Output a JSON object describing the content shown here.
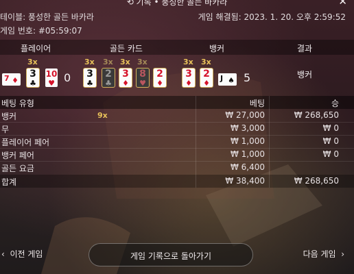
{
  "header": {
    "title": "⟲ 기록 • 풍성한 골든 바카라",
    "close_icon": "close-icon",
    "table_label": "테이블: 풍성한 골든 바카라",
    "settled_label": "게임 해결됨: 2023. 1. 20. 오후 2:59:52",
    "game_number_label": "게임 번호: #05:59:07"
  },
  "result_table": {
    "columns": [
      "플레이어",
      "골든 카드",
      "뱅커",
      "결과"
    ],
    "player": {
      "cards": [
        {
          "rank": "7",
          "suit": "♦",
          "color": "red",
          "sideways": true
        },
        {
          "rank": "3",
          "suit": "♣",
          "color": "black",
          "multiplier": "3x"
        },
        {
          "rank": "10",
          "suit": "♥",
          "color": "red"
        }
      ],
      "score": "0"
    },
    "golden_cards": [
      {
        "rank": "3",
        "suit": "♣",
        "color": "black",
        "multiplier": "3x",
        "active": true
      },
      {
        "rank": "2",
        "suit": "♣",
        "color": "black",
        "multiplier": "3x",
        "active": false
      },
      {
        "rank": "3",
        "suit": "♦",
        "color": "red",
        "multiplier": "3x",
        "active": true
      },
      {
        "rank": "8",
        "suit": "♥",
        "color": "red",
        "multiplier": "3x",
        "active": false
      },
      {
        "rank": "2",
        "suit": "♦",
        "color": "red",
        "multiplier": "",
        "active": true
      }
    ],
    "banker": {
      "cards": [
        {
          "rank": "3",
          "suit": "♦",
          "color": "red",
          "multiplier": "3x"
        },
        {
          "rank": "2",
          "suit": "♦",
          "color": "red",
          "multiplier": "3x"
        },
        {
          "rank": "J",
          "suit": "♠",
          "color": "black",
          "sideways": true
        }
      ],
      "score": "5"
    },
    "result": "뱅커"
  },
  "bets": {
    "headers": {
      "type": "베팅 유형",
      "bet": "베팅",
      "win": "승"
    },
    "rows": [
      {
        "type": "뱅커",
        "multiplier": "9x",
        "bet": "₩ 27,000",
        "win": "₩ 268,650"
      },
      {
        "type": "무",
        "multiplier": "",
        "bet": "₩ 3,000",
        "win": "₩ 0"
      },
      {
        "type": "플레이어 페어",
        "multiplier": "",
        "bet": "₩ 1,000",
        "win": "₩ 0"
      },
      {
        "type": "뱅커 페어",
        "multiplier": "",
        "bet": "₩ 1,000",
        "win": "₩ 0"
      },
      {
        "type": "골든 요금",
        "multiplier": "",
        "bet": "₩ 6,400",
        "win": ""
      }
    ],
    "total": {
      "type": "합계",
      "bet": "₩ 38,400",
      "win": "₩ 268,650"
    }
  },
  "footer": {
    "prev_label": "이전 게임",
    "back_label": "게임 기록으로 돌아가기",
    "next_label": "다음 게임"
  },
  "colors": {
    "gold": "#e8c25a",
    "card_red": "#d5122a",
    "card_black": "#111111"
  }
}
